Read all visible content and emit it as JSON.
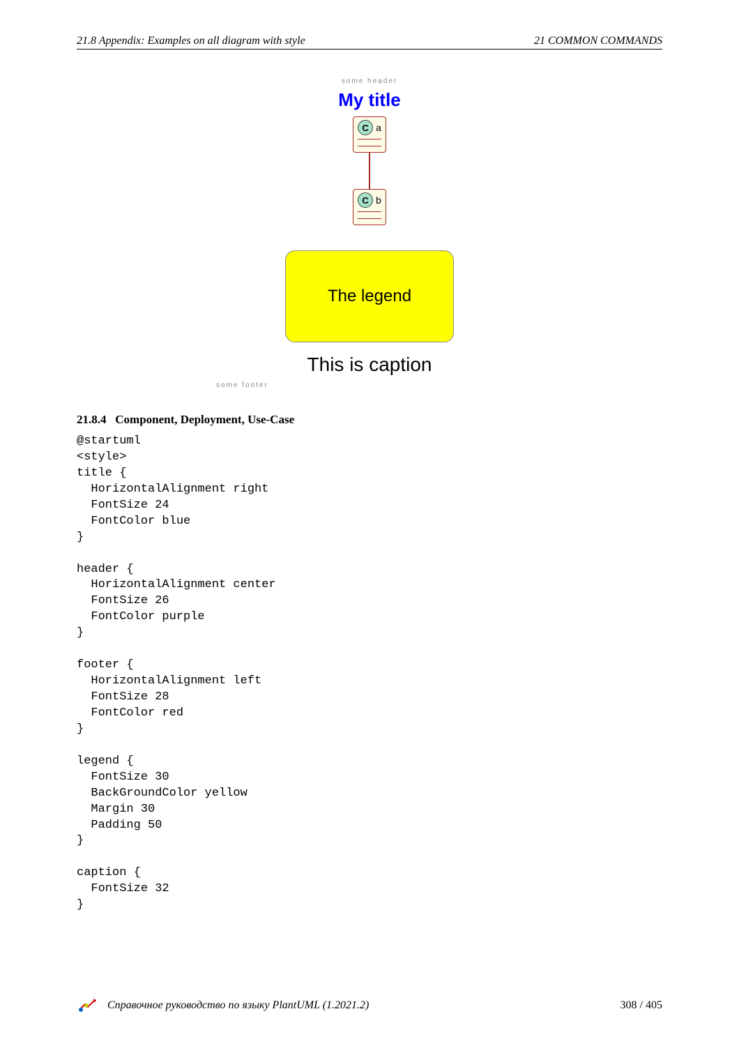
{
  "header": {
    "left": "21.8    Appendix: Examples on all diagram with style",
    "right": "21    COMMON COMMANDS"
  },
  "diagram": {
    "small_header": "some header",
    "title": "My title",
    "class_a_icon": "C",
    "class_a_label": "a",
    "class_b_icon": "C",
    "class_b_label": "b",
    "legend": "The legend",
    "caption": "This is caption",
    "small_footer": "some footer"
  },
  "section": {
    "number": "21.8.4",
    "title": "Component, Deployment, Use-Case"
  },
  "code": "@startuml\n<style>\ntitle {\n  HorizontalAlignment right\n  FontSize 24\n  FontColor blue\n}\n\nheader {\n  HorizontalAlignment center\n  FontSize 26\n  FontColor purple\n}\n\nfooter {\n  HorizontalAlignment left\n  FontSize 28\n  FontColor red\n}\n\nlegend {\n  FontSize 30\n  BackGroundColor yellow\n  Margin 30\n  Padding 50\n}\n\ncaption {\n  FontSize 32\n}",
  "footer": {
    "doc_title": "Справочное руководство по языку PlantUML (1.2021.2)",
    "page_current": "308",
    "page_total": "405"
  }
}
